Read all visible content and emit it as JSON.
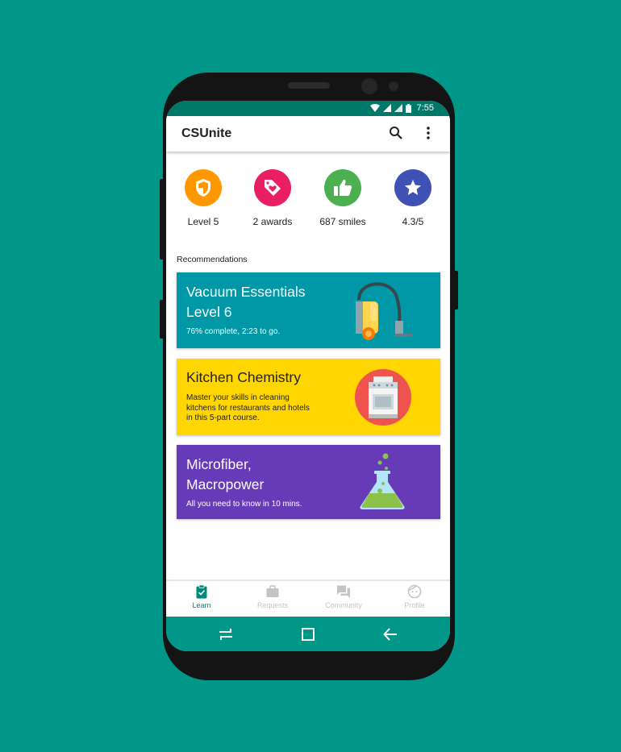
{
  "status_bar": {
    "time": "7:55"
  },
  "app_bar": {
    "title": "CSUnite",
    "search_icon": "search-icon",
    "menu_icon": "more-vert-icon"
  },
  "stats": [
    {
      "label": "Level 5",
      "icon": "shield-icon",
      "color": "#FF9800"
    },
    {
      "label": "2 awards",
      "icon": "tag-heart-icon",
      "color": "#E91E63"
    },
    {
      "label": "687 smiles",
      "icon": "thumbs-up-icon",
      "color": "#4CAF50"
    },
    {
      "label": "4.3/5",
      "icon": "star-icon",
      "color": "#3F51B5"
    }
  ],
  "recommendations": {
    "heading": "Recommendations",
    "cards": [
      {
        "title_line1": "Vacuum Essentials",
        "title_line2": "Level 6",
        "desc_line1": "76% complete, 2:23 to go.",
        "color": "#0097A7",
        "icon": "vacuum-icon"
      },
      {
        "title_line1": "Kitchen Chemistry",
        "desc_line1": "Master your skills in cleaning",
        "desc_line2": "kitchens for restaurants and hotels",
        "desc_line3": "in this 5-part course.",
        "color": "#FFD600",
        "icon": "stove-icon"
      },
      {
        "title_line1": "Microfiber,",
        "title_line2": "Macropower",
        "desc_line1": "All you need to know in 10 mins.",
        "color": "#673AB7",
        "icon": "flask-icon"
      }
    ]
  },
  "bottom_nav": [
    {
      "label": "Learn",
      "icon": "clipboard-icon",
      "active": true
    },
    {
      "label": "Requests",
      "icon": "briefcase-icon",
      "active": false
    },
    {
      "label": "Community",
      "icon": "chat-icon",
      "active": false
    },
    {
      "label": "Profile",
      "icon": "face-icon",
      "active": false
    }
  ],
  "system_nav": {
    "recents_icon": "recents-icon",
    "home_icon": "home-square-icon",
    "back_icon": "back-arrow-icon"
  }
}
